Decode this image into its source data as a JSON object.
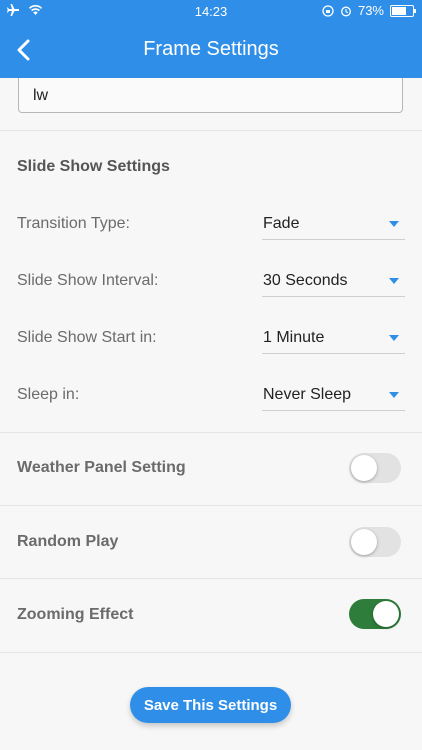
{
  "status_bar": {
    "time": "14:23",
    "battery": "73%",
    "battery_level": 0.73
  },
  "header": {
    "title": "Frame Settings"
  },
  "name_input": {
    "value": "lw"
  },
  "slide_show": {
    "title": "Slide Show Settings",
    "rows": [
      {
        "label": "Transition Type:",
        "value": "Fade"
      },
      {
        "label": "Slide Show Interval:",
        "value": "30 Seconds"
      },
      {
        "label": "Slide Show Start in:",
        "value": "1 Minute"
      },
      {
        "label": "Sleep in:",
        "value": "Never Sleep"
      }
    ]
  },
  "toggles": [
    {
      "label": "Weather Panel Setting",
      "on": false
    },
    {
      "label": "Random Play",
      "on": false
    },
    {
      "label": "Zooming Effect",
      "on": true
    }
  ],
  "save_button": {
    "label": "Save This Settings"
  },
  "colors": {
    "primary": "#2f8fe8",
    "toggle_on": "#2e7d3a"
  }
}
